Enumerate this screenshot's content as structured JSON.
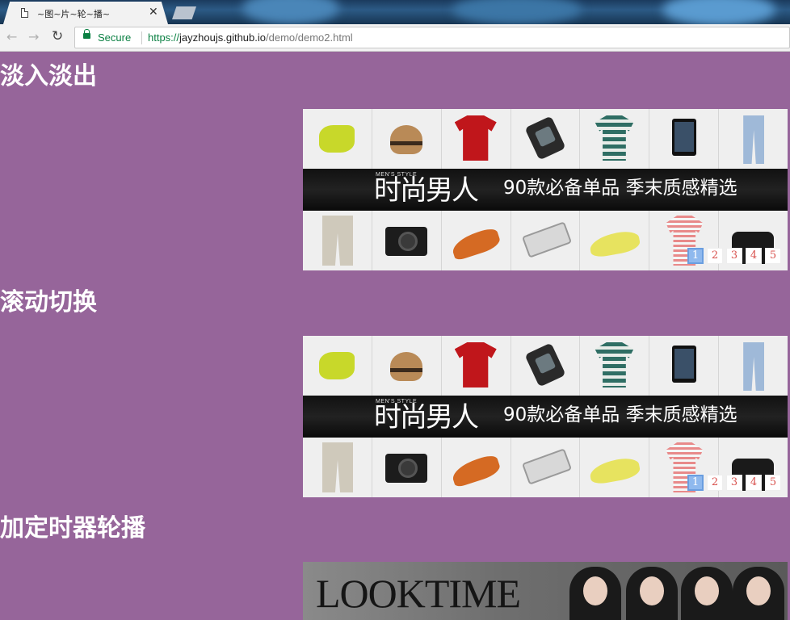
{
  "browser": {
    "tab_title": "~图~片~轮~播~",
    "secure_label": "Secure",
    "url_scheme": "https://",
    "url_host": "jayzhoujs.github.io",
    "url_path": "/demo/demo2.html"
  },
  "sections": [
    {
      "heading": "淡入淡出",
      "banner": {
        "brand_small": "MEN'S STYLE",
        "brand": "时尚男人",
        "slogan": "90款必备单品  季末质感精选",
        "pager": [
          "1",
          "2",
          "3",
          "4",
          "5"
        ],
        "active": 1
      }
    },
    {
      "heading": "滚动切换",
      "banner": {
        "brand_small": "MEN'S STYLE",
        "brand": "时尚男人",
        "slogan": "90款必备单品  季末质感精选",
        "pager": [
          "1",
          "2",
          "3",
          "4",
          "5"
        ],
        "active": 1
      }
    },
    {
      "heading": "加定时器轮播",
      "banner": {
        "magazine": "LOOKTIME"
      }
    }
  ],
  "colors": {
    "page_bg": "#96659a",
    "pager_active": "#8fb9ee",
    "pager_text": "#d9534f",
    "secure_green": "#0b8043"
  }
}
